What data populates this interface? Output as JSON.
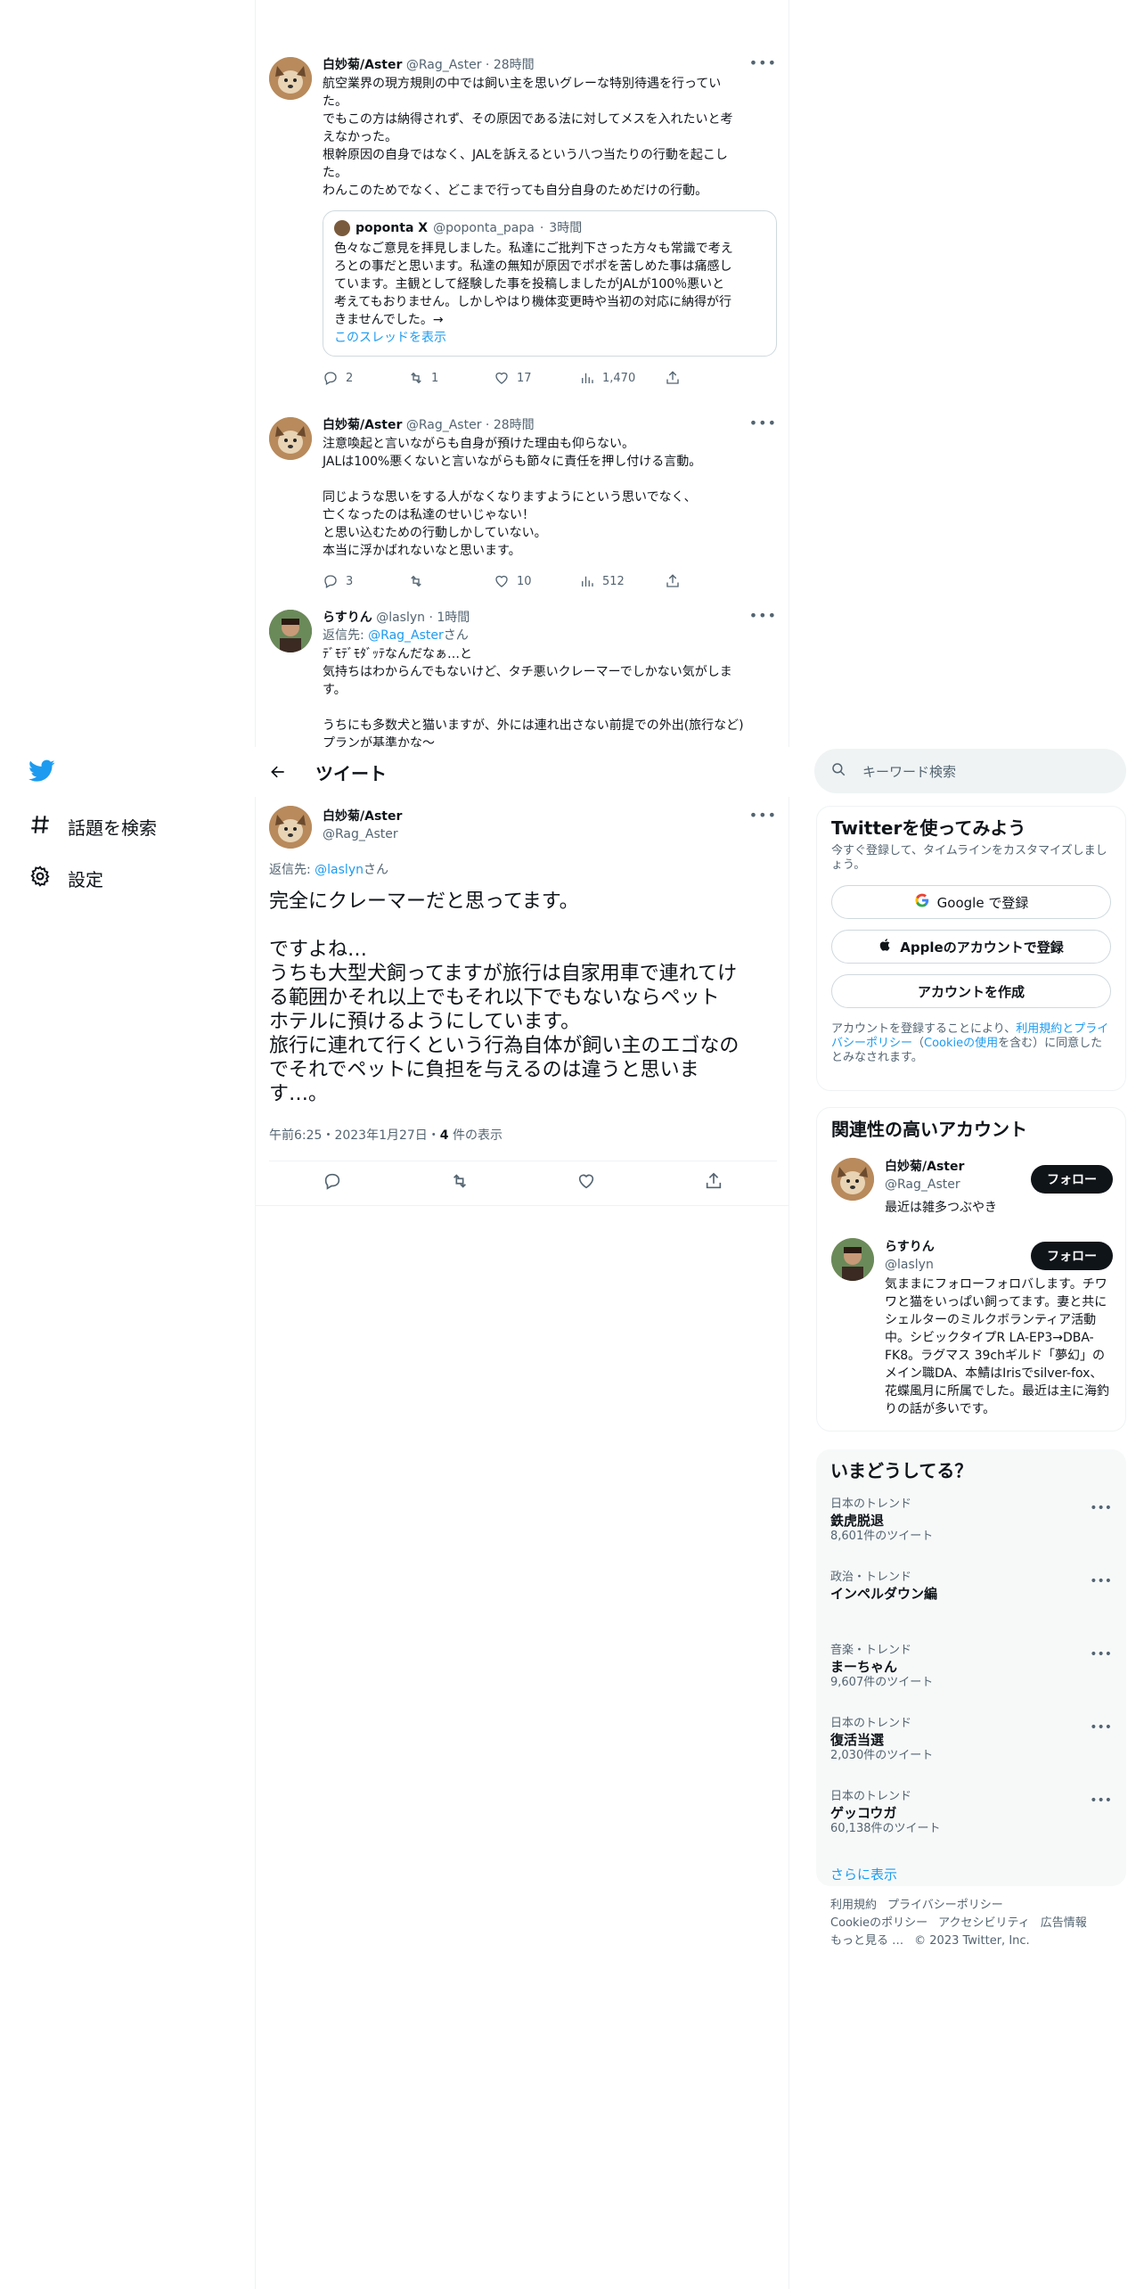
{
  "colors": {
    "accent": "#1d9bf0",
    "text": "#0f1419",
    "muted": "#536471"
  },
  "nav": {
    "logo": "twitter-bird-icon",
    "items": [
      {
        "label": "話題を検索",
        "icon": "hashtag-icon"
      },
      {
        "label": "設定",
        "icon": "gear-icon"
      }
    ]
  },
  "thread": [
    {
      "name": "白妙菊/Aster",
      "handle": "@Rag_Aster",
      "time": "28時間",
      "text": "航空業界の現方規則の中では飼い主を思いグレーな特別待遇を行ってい\nた。\nでもこの方は納得されず、その原因である法に対してメスを入れたいと考\nえなかった。\n根幹原因の自身ではなく、JALを訴えるという八つ当たりの行動を起こし\nた。\nわんこのためでなく、どこまで行っても自分自身のためだけの行動。",
      "quote": {
        "name": "poponta X",
        "handle": "@poponta_papa",
        "time": "3時間",
        "text": "色々なご意見を拝見しました。私達にご批判下さった方々も常識で考え\nろとの事だと思います。私達の無知が原因でポポを苦しめた事は痛感し\nています。主観として経験した事を投稿しましたがJALが100％悪いと\n考えてもおりません。しかしやはり機体変更時や当初の対応に納得が行\nきませんでした。→",
        "link": "このスレッドを表示"
      },
      "replies": "2",
      "retweets": "1",
      "likes": "17",
      "views": "1,470"
    },
    {
      "name": "白妙菊/Aster",
      "handle": "@Rag_Aster",
      "time": "28時間",
      "text": "注意喚起と言いながらも自身が預けた理由も仰らない。\nJALは100%悪くないと言いながらも節々に責任を押し付ける言動。\n\n同じような思いをする人がなくなりますようにという思いでなく、\n亡くなったのは私達のせいじゃない！\nと思い込むための行動しかしていない。\n本当に浮かばれないなと思います。",
      "replies": "3",
      "retweets": "",
      "likes": "10",
      "views": "512"
    },
    {
      "name": "らすりん",
      "handle": "@laslyn",
      "time": "1時間",
      "reply_prefix": "返信先: ",
      "reply_to": "@Rag_Aster",
      "reply_suffix": "さん",
      "text": "ﾃﾞﾓﾃﾞﾓﾀﾞｯﾃなんだなぁ…と\n気持ちはわからんでもないけど、タチ悪いクレーマーでしかない気がしま\nす。\n\nうちにも多数犬と猫いますが、外には連れ出さない前提での外出(旅行など)\nプランが基準かな～"
    }
  ],
  "main": {
    "header_title": "ツイート",
    "name": "白妙菊/Aster",
    "handle": "@Rag_Aster",
    "reply_prefix": "返信先: ",
    "reply_to": "@laslyn",
    "reply_suffix": "さん",
    "text": "完全にクレーマーだと思ってます。\n\nですよね…\nうちも大型犬飼ってますが旅行は自家用車で連れてけ\nる範囲かそれ以上でもそれ以下でもないならペット\nホテルに預けるようにしています。\n旅行に連れて行くという行為自体が飼い主のエゴなの\nでそれでペットに負担を与えるのは違うと思いま\nす…。",
    "timestamp": "午前6:25・2023年1月27日・",
    "views_count": "4",
    "views_label": " 件の表示"
  },
  "sidebar": {
    "search_placeholder": "キーワード検索",
    "signup": {
      "title": "Twitterを使ってみよう",
      "subtitle": "今すぐ登録して、タイムラインをカスタマイズしましょう。",
      "google": "Google で登録",
      "apple": "Appleのアカウントで登録",
      "create": "アカウントを作成",
      "legal_1": "アカウントを登録することにより、",
      "legal_terms": "利用規約とプライバシーポリシー",
      "legal_2": "（",
      "legal_cookie": "Cookieの使用",
      "legal_3": "を含む）に同意したとみなされます。"
    },
    "related": {
      "title": "関連性の高いアカウント",
      "follow_label": "フォロー",
      "accounts": [
        {
          "name": "白妙菊/Aster",
          "handle": "@Rag_Aster",
          "bio": "最近は雑多つぶやき"
        },
        {
          "name": "らすりん",
          "handle": "@laslyn",
          "bio": "気ままにフォローフォロバします。チワワと猫をいっぱい飼ってます。妻と共にシェルターのミルクボランティア活動中。シビックタイプR LA-EP3→DBA-FK8。ラグマス 39chギルド「夢幻」のメイン職DA、本鯖はIrisでsilver-fox、花蝶風月に所属でした。最近は主に海釣りの話が多いです。"
        }
      ]
    },
    "trends": {
      "title": "いまどうしてる？",
      "items": [
        {
          "category": "日本のトレンド",
          "name": "鉄虎脱退",
          "count": "8,601件のツイート"
        },
        {
          "category": "政治・トレンド",
          "name": "インペルダウン編",
          "count": ""
        },
        {
          "category": "音楽・トレンド",
          "name": "まーちゃん",
          "count": "9,607件のツイート"
        },
        {
          "category": "日本のトレンド",
          "name": "復活当選",
          "count": "2,030件のツイート"
        },
        {
          "category": "日本のトレンド",
          "name": "ゲッコウガ",
          "count": "60,138件のツイート"
        }
      ],
      "show_more": "さらに表示"
    },
    "footer": {
      "links": [
        "利用規約",
        "プライバシーポリシー",
        "Cookieのポリシー",
        "アクセシビリティ",
        "広告情報",
        "もっと見る …"
      ],
      "copyright": "© 2023 Twitter, Inc."
    }
  }
}
